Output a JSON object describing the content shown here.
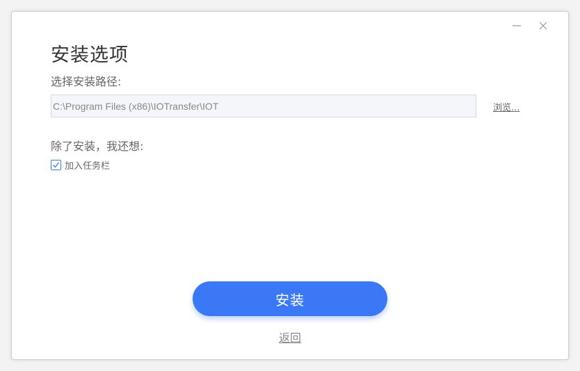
{
  "window": {
    "minimize_icon": "minimize-icon",
    "close_icon": "close-icon"
  },
  "header": {
    "title": "安装选项"
  },
  "install_path": {
    "label": "选择安装路径:",
    "value": "C:\\Program Files (x86)\\IOTransfer\\IOT",
    "browse_label": "浏览..."
  },
  "extras": {
    "label": "除了安装，我还想:",
    "options": [
      {
        "label": "加入任务栏",
        "checked": true
      }
    ]
  },
  "actions": {
    "install_label": "安装",
    "back_label": "返回"
  },
  "colors": {
    "accent": "#3a78f5",
    "text_primary": "#333333",
    "text_secondary": "#666666"
  }
}
